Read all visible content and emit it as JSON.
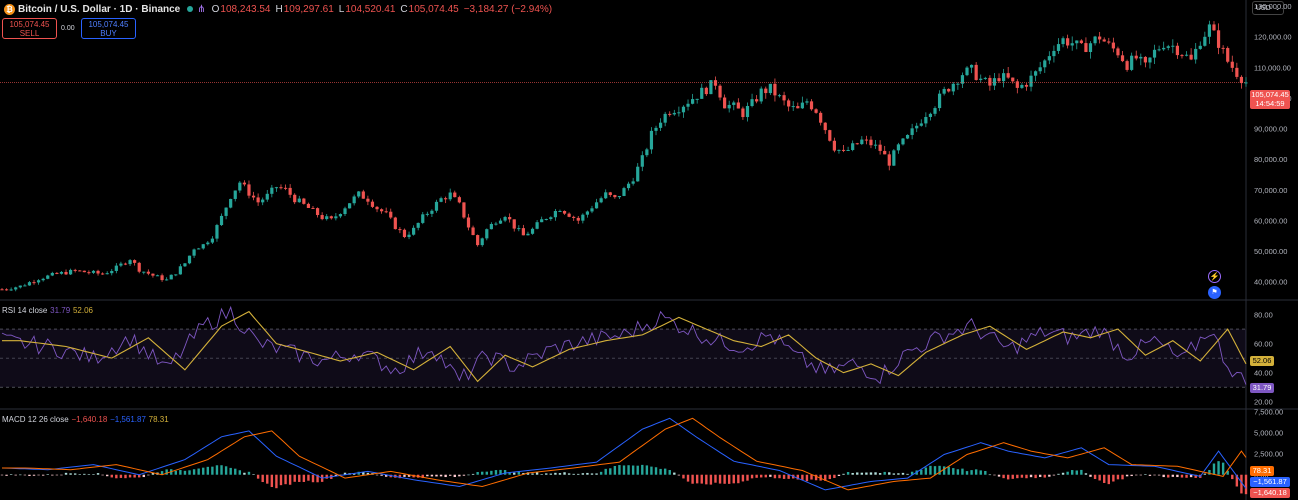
{
  "header": {
    "symbol_title": "Bitcoin / U.S. Dollar · 1D · Binance",
    "ohlc": [
      {
        "k": "O",
        "v": "108,243.54"
      },
      {
        "k": "H",
        "v": "109,297.61"
      },
      {
        "k": "L",
        "v": "104,520.41"
      },
      {
        "k": "C",
        "v": "105,074.45"
      }
    ],
    "change": "−3,184.27 (−2.94%)",
    "sell_price": "105,074.45",
    "sell_label": "SELL",
    "spread": "0.00",
    "buy_price": "105,074.45",
    "buy_label": "BUY",
    "currency": "USD"
  },
  "colors": {
    "up": "#26a69a",
    "down": "#ef5350",
    "rsi": "#7e57c2",
    "rsi_ma": "#d4b13a",
    "macd": "#2962ff",
    "signal": "#ff6d00"
  },
  "icons": {
    "btc": "bitcoin-icon",
    "share": "share-icon"
  },
  "price_axis": {
    "ticks": [
      "130,000.00",
      "120,000.00",
      "110,000.00",
      "100,000.00",
      "90,000.00",
      "80,000.00",
      "70,000.00",
      "60,000.00",
      "50,000.00",
      "40,000.00"
    ],
    "last_price_label": "105,074.45",
    "countdown": "14:54:59"
  },
  "rsi_pane": {
    "label": "RSI 14 close",
    "rsi_value": "31.79",
    "ma_value": "52.06",
    "ticks": [
      "80.00",
      "60.00",
      "40.00",
      "20.00"
    ]
  },
  "macd_pane": {
    "label": "MACD 12 26 close",
    "macd_value": "−1,640.18",
    "signal_value": "−1,561.87",
    "hist_value": "78.31",
    "ticks": [
      "7,500.00",
      "5,000.00",
      "2,500.00",
      "0.00"
    ]
  },
  "chart_data": {
    "type": "candlestick",
    "title": "Bitcoin / U.S. Dollar · 1D · Binance",
    "ylim": [
      34000,
      132000
    ],
    "last_price": 105074.45,
    "close_path": [
      [
        0,
        37500
      ],
      [
        4,
        38500
      ],
      [
        8,
        41000
      ],
      [
        12,
        42500
      ],
      [
        16,
        43500
      ],
      [
        19,
        43000
      ],
      [
        22,
        42500
      ],
      [
        25,
        44500
      ],
      [
        28,
        47500
      ],
      [
        30,
        44000
      ],
      [
        33,
        42000
      ],
      [
        36,
        40500
      ],
      [
        38,
        43000
      ],
      [
        40,
        46000
      ],
      [
        42,
        51000
      ],
      [
        44,
        52000
      ],
      [
        46,
        55000
      ],
      [
        48,
        61000
      ],
      [
        50,
        68000
      ],
      [
        52,
        72500
      ],
      [
        54,
        69000
      ],
      [
        56,
        66000
      ],
      [
        58,
        68000
      ],
      [
        60,
        71000
      ],
      [
        62,
        70000
      ],
      [
        64,
        67000
      ],
      [
        66,
        65000
      ],
      [
        68,
        63000
      ],
      [
        70,
        61000
      ],
      [
        72,
        60000
      ],
      [
        74,
        63000
      ],
      [
        76,
        66000
      ],
      [
        78,
        68500
      ],
      [
        80,
        67000
      ],
      [
        82,
        64000
      ],
      [
        84,
        62000
      ],
      [
        86,
        58000
      ],
      [
        88,
        55000
      ],
      [
        90,
        57000
      ],
      [
        92,
        61000
      ],
      [
        94,
        64000
      ],
      [
        96,
        67000
      ],
      [
        98,
        68500
      ],
      [
        100,
        65000
      ],
      [
        102,
        58000
      ],
      [
        104,
        52000
      ],
      [
        106,
        57000
      ],
      [
        108,
        60000
      ],
      [
        110,
        62000
      ],
      [
        112,
        58000
      ],
      [
        114,
        55000
      ],
      [
        116,
        57000
      ],
      [
        118,
        60000
      ],
      [
        120,
        62000
      ],
      [
        122,
        64000
      ],
      [
        124,
        62000
      ],
      [
        126,
        60000
      ],
      [
        128,
        63000
      ],
      [
        130,
        66000
      ],
      [
        132,
        68500
      ],
      [
        134,
        67000
      ],
      [
        136,
        70000
      ],
      [
        138,
        74000
      ],
      [
        140,
        80000
      ],
      [
        142,
        88000
      ],
      [
        144,
        93000
      ],
      [
        146,
        96000
      ],
      [
        148,
        97000
      ],
      [
        150,
        99000
      ],
      [
        152,
        101000
      ],
      [
        154,
        103000
      ],
      [
        156,
        105000
      ],
      [
        158,
        98000
      ],
      [
        160,
        97000
      ],
      [
        162,
        95000
      ],
      [
        164,
        98000
      ],
      [
        166,
        102000
      ],
      [
        168,
        103000
      ],
      [
        170,
        100000
      ],
      [
        172,
        97000
      ],
      [
        174,
        96000
      ],
      [
        176,
        99000
      ],
      [
        178,
        96000
      ],
      [
        180,
        90000
      ],
      [
        182,
        84000
      ],
      [
        184,
        82000
      ],
      [
        186,
        84000
      ],
      [
        188,
        86000
      ],
      [
        190,
        85000
      ],
      [
        192,
        83000
      ],
      [
        194,
        79000
      ],
      [
        196,
        84000
      ],
      [
        198,
        87000
      ],
      [
        200,
        91000
      ],
      [
        202,
        95000
      ],
      [
        204,
        98000
      ],
      [
        206,
        102000
      ],
      [
        208,
        105000
      ],
      [
        210,
        108000
      ],
      [
        212,
        109000
      ],
      [
        214,
        106000
      ],
      [
        216,
        104000
      ],
      [
        218,
        107000
      ],
      [
        220,
        106000
      ],
      [
        222,
        103000
      ],
      [
        224,
        105000
      ],
      [
        226,
        108000
      ],
      [
        228,
        112000
      ],
      [
        230,
        117000
      ],
      [
        232,
        119000
      ],
      [
        234,
        118000
      ],
      [
        236,
        116000
      ],
      [
        238,
        118000
      ],
      [
        240,
        120000
      ],
      [
        242,
        117000
      ],
      [
        244,
        115000
      ],
      [
        246,
        111000
      ],
      [
        248,
        113000
      ],
      [
        250,
        110000
      ],
      [
        252,
        115000
      ],
      [
        254,
        118000
      ],
      [
        256,
        117000
      ],
      [
        258,
        115000
      ],
      [
        260,
        112000
      ],
      [
        262,
        119000
      ],
      [
        264,
        123000
      ],
      [
        266,
        118000
      ],
      [
        268,
        112000
      ],
      [
        270,
        108243
      ],
      [
        272,
        105074
      ]
    ],
    "rsi_path": [
      [
        0,
        62
      ],
      [
        10,
        58
      ],
      [
        20,
        50
      ],
      [
        28,
        64
      ],
      [
        36,
        42
      ],
      [
        44,
        72
      ],
      [
        50,
        82
      ],
      [
        56,
        60
      ],
      [
        62,
        55
      ],
      [
        70,
        48
      ],
      [
        78,
        54
      ],
      [
        86,
        42
      ],
      [
        94,
        58
      ],
      [
        100,
        34
      ],
      [
        106,
        52
      ],
      [
        112,
        44
      ],
      [
        120,
        56
      ],
      [
        128,
        62
      ],
      [
        136,
        66
      ],
      [
        144,
        78
      ],
      [
        150,
        70
      ],
      [
        156,
        62
      ],
      [
        162,
        58
      ],
      [
        168,
        66
      ],
      [
        174,
        50
      ],
      [
        180,
        40
      ],
      [
        186,
        46
      ],
      [
        192,
        38
      ],
      [
        198,
        54
      ],
      [
        206,
        66
      ],
      [
        212,
        72
      ],
      [
        220,
        56
      ],
      [
        228,
        68
      ],
      [
        234,
        64
      ],
      [
        240,
        70
      ],
      [
        246,
        52
      ],
      [
        252,
        62
      ],
      [
        258,
        48
      ],
      [
        264,
        70
      ],
      [
        268,
        46
      ],
      [
        272,
        31.79
      ]
    ],
    "macd_path": [
      [
        0,
        800
      ],
      [
        10,
        600
      ],
      [
        20,
        1200
      ],
      [
        30,
        0
      ],
      [
        40,
        1800
      ],
      [
        48,
        4500
      ],
      [
        54,
        5200
      ],
      [
        60,
        2200
      ],
      [
        70,
        -400
      ],
      [
        80,
        400
      ],
      [
        90,
        -600
      ],
      [
        100,
        -1400
      ],
      [
        110,
        200
      ],
      [
        120,
        800
      ],
      [
        130,
        1500
      ],
      [
        140,
        5400
      ],
      [
        146,
        6700
      ],
      [
        152,
        4400
      ],
      [
        160,
        1600
      ],
      [
        170,
        500
      ],
      [
        180,
        -1800
      ],
      [
        190,
        -800
      ],
      [
        198,
        -400
      ],
      [
        206,
        2400
      ],
      [
        214,
        3800
      ],
      [
        220,
        2800
      ],
      [
        228,
        2000
      ],
      [
        236,
        3200
      ],
      [
        242,
        1200
      ],
      [
        252,
        1000
      ],
      [
        262,
        -200
      ],
      [
        266,
        2800
      ],
      [
        272,
        -1640.18
      ]
    ],
    "xlabel": "",
    "ylabel": ""
  }
}
